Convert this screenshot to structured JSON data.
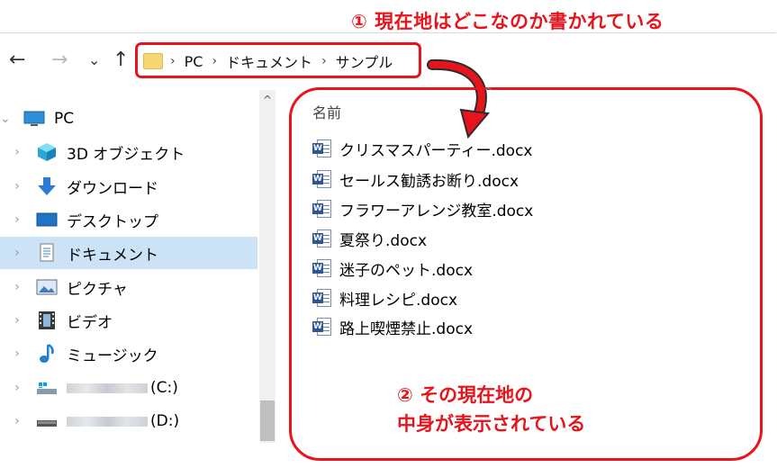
{
  "annotations": {
    "top": "① 現在地はどこなのか書かれている",
    "bottom_line1": "② その現在地の",
    "bottom_line2": "中身が表示されている"
  },
  "navigation": {
    "back": "←",
    "forward": "→",
    "recent": "⌄",
    "up": "↑"
  },
  "address_bar": {
    "crumbs": [
      "PC",
      "ドキュメント",
      "サンプル"
    ],
    "separator": "›"
  },
  "sidebar": {
    "items": [
      {
        "label": "PC",
        "icon": "monitor-icon"
      },
      {
        "label": "3D オブジェクト",
        "icon": "cube-icon"
      },
      {
        "label": "ダウンロード",
        "icon": "download-arrow-icon"
      },
      {
        "label": "デスクトップ",
        "icon": "desktop-icon"
      },
      {
        "label": "ドキュメント",
        "icon": "document-icon"
      },
      {
        "label": "ピクチャ",
        "icon": "picture-icon"
      },
      {
        "label": "ビデオ",
        "icon": "film-icon"
      },
      {
        "label": "ミュージック",
        "icon": "music-note-icon"
      },
      {
        "label": "(C:)",
        "icon": "drive-icon"
      },
      {
        "label": "(D:)",
        "icon": "drive-icon"
      }
    ],
    "expand_glyph": "›",
    "collapse_glyph": "⌄"
  },
  "file_list": {
    "column_header": "名前",
    "sort_caret": "^",
    "files": [
      "クリスマスパーティー.docx",
      "セールス勧誘お断り.docx",
      "フラワーアレンジ教室.docx",
      "夏祭り.docx",
      "迷子のペット.docx",
      "料理レシピ.docx",
      "路上喫煙禁止.docx"
    ],
    "file_icon_letter": "W"
  },
  "colors": {
    "annotation_red": "#e8141c",
    "selection_blue": "#cce3f7",
    "word_blue": "#2b579a"
  }
}
